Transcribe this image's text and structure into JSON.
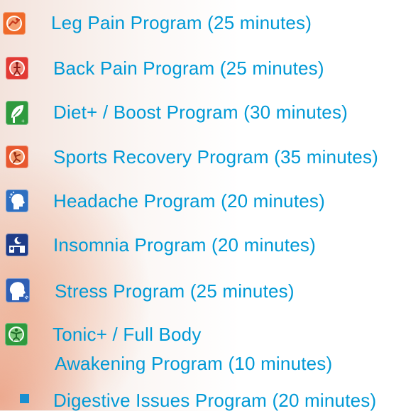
{
  "programs": [
    {
      "label": "Leg Pain Program (25 minutes)",
      "icon": "leg-pain-icon"
    },
    {
      "label": "Back Pain Program (25 minutes)",
      "icon": "back-pain-icon"
    },
    {
      "label": "Diet+ / Boost Program (30 minutes)",
      "icon": "diet-boost-icon"
    },
    {
      "label": "Sports Recovery Program (35 minutes)",
      "icon": "sports-recovery-icon"
    },
    {
      "label": "Headache Program (20 minutes)",
      "icon": "headache-icon"
    },
    {
      "label": "Insomnia Program (20 minutes)",
      "icon": "insomnia-icon"
    },
    {
      "label": "Stress Program (25 minutes)",
      "icon": "stress-icon"
    },
    {
      "label_line1": "Tonic+ / Full Body",
      "label_line2": "Awakening Program (10 minutes)",
      "icon": "tonic-full-body-icon"
    },
    {
      "label": "Digestive Issues Program (20 minutes)",
      "icon": "bullet-icon"
    }
  ],
  "colors": {
    "text": "#0099d6",
    "orange_icon": "#f06a2a",
    "red_icon": "#e23a34",
    "green_icon": "#2f9a3e",
    "blue_icon": "#2f6fc0",
    "navy_icon": "#1f3c88",
    "bullet": "#1a8fd0"
  }
}
